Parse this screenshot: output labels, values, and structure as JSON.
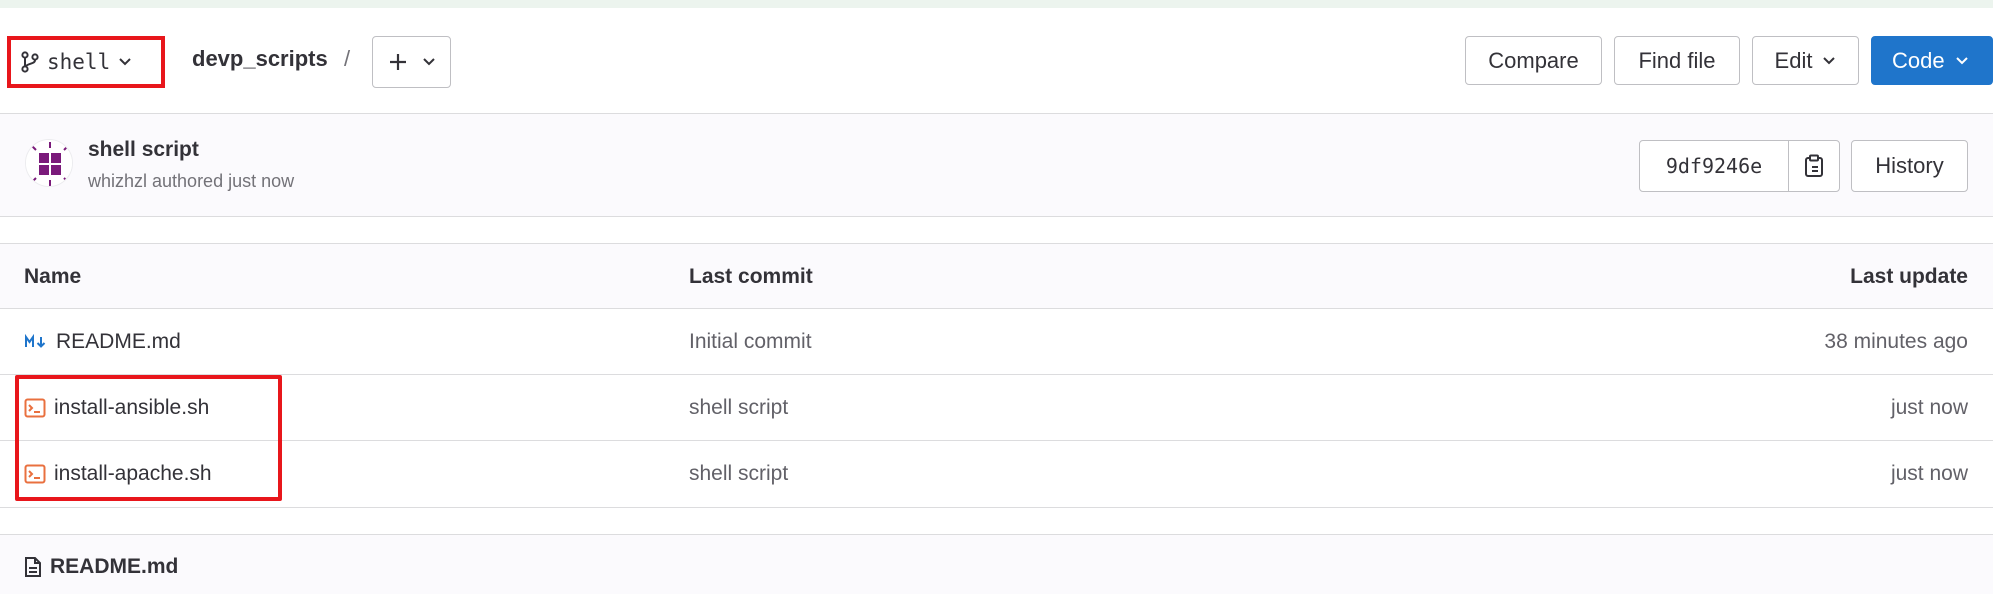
{
  "header": {
    "branch": "shell",
    "project": "devp_scripts",
    "separator": "/",
    "buttons": {
      "compare": "Compare",
      "find_file": "Find file",
      "edit": "Edit",
      "code": "Code"
    }
  },
  "commit": {
    "title": "shell script",
    "meta": "whizhzl authored just now",
    "sha": "9df9246e",
    "history_label": "History"
  },
  "table": {
    "headers": {
      "name": "Name",
      "last_commit": "Last commit",
      "last_update": "Last update"
    },
    "rows": [
      {
        "name": "README.md",
        "icon": "markdown-icon",
        "commit": "Initial commit",
        "updated": "38 minutes ago"
      },
      {
        "name": "install-ansible.sh",
        "icon": "terminal-file-icon",
        "commit": "shell script",
        "updated": "just now"
      },
      {
        "name": "install-apache.sh",
        "icon": "terminal-file-icon",
        "commit": "shell script",
        "updated": "just now"
      }
    ]
  },
  "readme": {
    "title": "README.md"
  },
  "colors": {
    "primary": "#1f75cb",
    "highlight": "#e8161b",
    "shell_icon": "#e9703f",
    "markdown_icon": "#1f75cb"
  }
}
